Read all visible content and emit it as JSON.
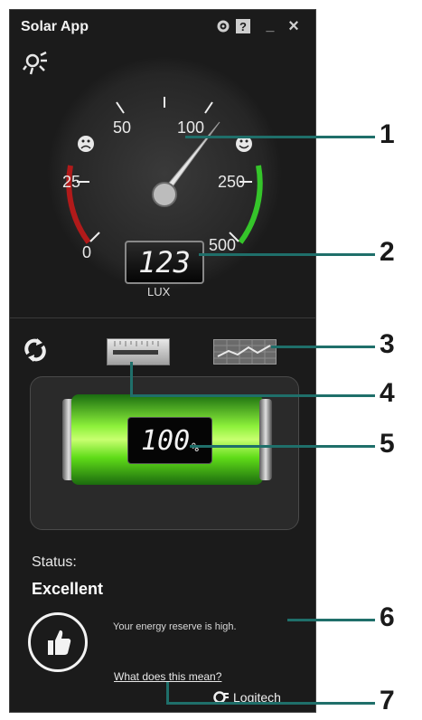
{
  "app": {
    "title": "Solar App",
    "controls": {
      "settings": "gear-icon",
      "help": "?",
      "minimize": "_",
      "close": "×"
    }
  },
  "gauge": {
    "ticks": [
      "0",
      "25",
      "50",
      "100",
      "250",
      "500"
    ],
    "reading": "123",
    "unit": "LUX",
    "needle_value": 100
  },
  "battery": {
    "value": "100",
    "unit": "%",
    "level": 1.0
  },
  "status": {
    "label": "Status:",
    "value": "Excellent",
    "message": "Your energy reserve is high.",
    "link": "What does this mean?"
  },
  "logo": {
    "text": "Logitech"
  },
  "callouts": [
    "1",
    "2",
    "3",
    "4",
    "5",
    "6",
    "7"
  ],
  "colors": {
    "accent_line": "#1f6f6a",
    "battery_green": "#5fdc18",
    "background": "#1b1b1b"
  }
}
